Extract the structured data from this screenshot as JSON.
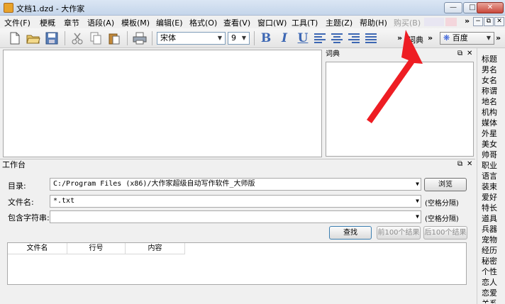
{
  "window": {
    "title": "文档1.dzd - 大作家",
    "controls": {
      "minimize": "—",
      "maximize": "□",
      "close": "✕"
    }
  },
  "menu": {
    "items": [
      "文件(F)",
      "梗概",
      "章节",
      "语段(A)",
      "模板(M)",
      "编辑(E)",
      "格式(O)",
      "查看(V)",
      "窗口(W)",
      "工具(T)",
      "主题(Z)",
      "帮助(H)"
    ],
    "buy": "购买(B)",
    "overflow": "»",
    "mdi": {
      "minimize": "−",
      "restore": "⧉",
      "close": "✕"
    }
  },
  "toolbar": {
    "font_name": "宋体",
    "font_size": "9",
    "format_buttons": {
      "bold": "B",
      "italic": "I",
      "underline": "U"
    },
    "overflow": "»",
    "dict_label": "词典",
    "search_engine": "百度",
    "overflow2": "»"
  },
  "dictionary_panel": {
    "title": "词典",
    "pin": "⧉",
    "close": "✕"
  },
  "tags": [
    "标题",
    "男名",
    "女名",
    "称谓",
    "地名",
    "机构",
    "媒体",
    "外星",
    "美女",
    "帅哥",
    "职业",
    "语言",
    "装束",
    "爱好",
    "特长",
    "道具",
    "兵器",
    "宠物",
    "经历",
    "秘密",
    "个性",
    "恋人",
    "恋爱",
    "关系"
  ],
  "workbench": {
    "title": "工作台",
    "pin": "⧉",
    "close": "✕",
    "directory_label": "目录:",
    "directory_value": "C:/Program Files (x86)/大作家超级自动写作软件_大师版",
    "browse_button": "浏览",
    "filename_label": "文件名:",
    "filename_value": "*.txt",
    "filename_hint": "(空格分隔)",
    "contains_label": "包含字符串:",
    "contains_value": "",
    "contains_hint": "(空格分隔)",
    "find_button": "查找",
    "prev_button": "前100个结果",
    "next_button": "后100个结果",
    "columns": [
      "文件名",
      "行号",
      "内容"
    ]
  },
  "colors": {
    "annotation_arrow": "#ee1d23",
    "format_blue": "#3d67b3"
  }
}
